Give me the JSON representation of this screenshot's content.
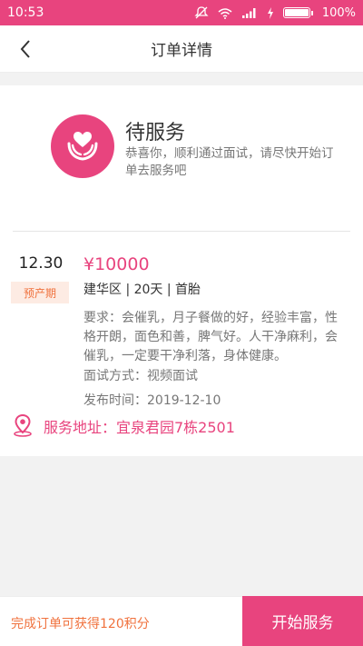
{
  "status_bar": {
    "time": "10:53",
    "battery": "100%",
    "icons": [
      "mute-icon",
      "wifi-icon",
      "signal-icon",
      "charging-icon",
      "battery-icon"
    ]
  },
  "nav": {
    "title": "订单详情",
    "back_icon": "chevron-left-icon"
  },
  "order_status": {
    "title": "待服务",
    "description": "恭喜你，顺利通过面试，请尽快开始订单去服务吧",
    "icon": "heart-hands-icon"
  },
  "order": {
    "date": "12.30",
    "badge": "预产期",
    "price": "¥10000",
    "attributes": "建华区 | 20天 | 首胎",
    "requirement": "要求：会催乳，月子餐做的好，经验丰富，性格开朗，面色和善，脾气好。人干净麻利，会催乳，一定要干净利落，身体健康。",
    "interview": "面试方式：视频面试",
    "publish_time": "发布时间：2019-12-10",
    "address": "服务地址：宜泉君园7栋2501",
    "address_icon": "location-pin-icon"
  },
  "footer": {
    "reward": "完成订单可获得120积分",
    "start_button": "开始服务"
  },
  "colors": {
    "accent": "#e8447e",
    "orange": "#f0723e",
    "badge_bg": "#fdebe3"
  }
}
